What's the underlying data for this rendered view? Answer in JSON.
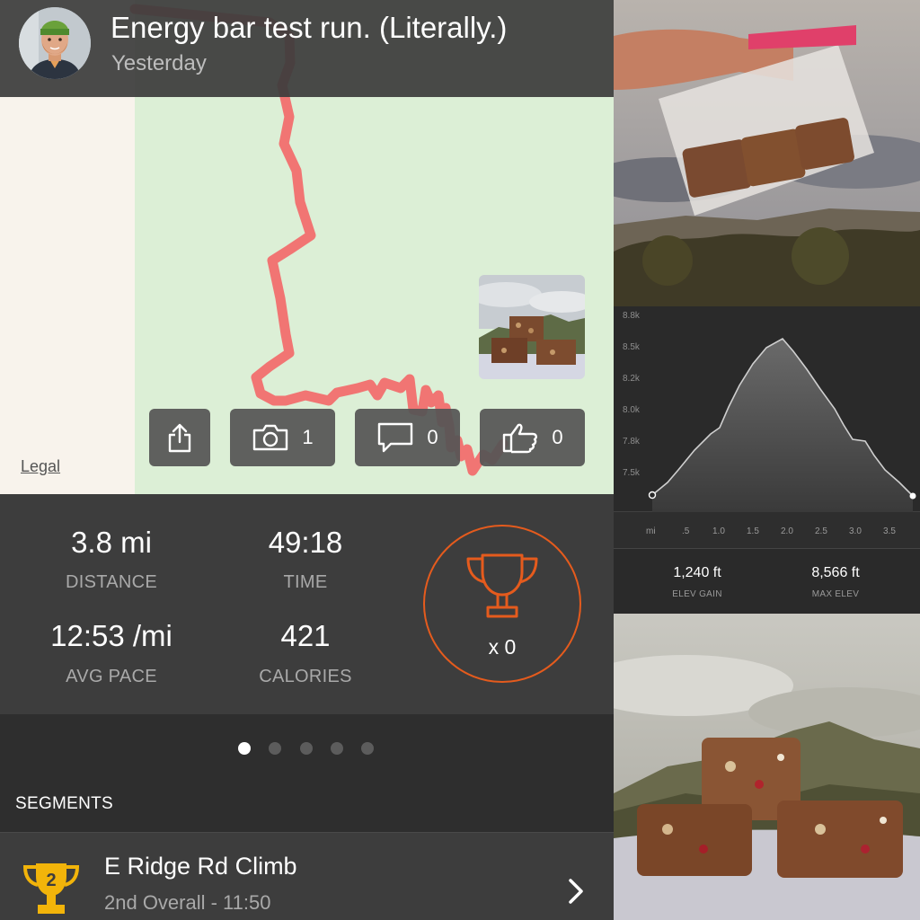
{
  "activity": {
    "title": "Energy bar test run. (Literally.)",
    "date": "Yesterday"
  },
  "map": {
    "legal_label": "Legal"
  },
  "actions": {
    "share_icon": "share-icon",
    "photos_count": "1",
    "comments_count": "0",
    "kudos_count": "0"
  },
  "stats": {
    "distance": {
      "value": "3.8 mi",
      "label": "DISTANCE"
    },
    "time": {
      "value": "49:18",
      "label": "TIME"
    },
    "pace": {
      "value": "12:53 /mi",
      "label": "AVG PACE"
    },
    "calories": {
      "value": "421",
      "label": "CALORIES"
    },
    "achievements": "x 0"
  },
  "pager": {
    "pages": 5,
    "active": 0
  },
  "segments": {
    "header": "SEGMENTS",
    "items": [
      {
        "name": "E Ridge Rd Climb",
        "detail": "2nd Overall - 11:50",
        "rank": "2"
      }
    ]
  },
  "elevation": {
    "y_ticks": [
      "8.8k",
      "8.5k",
      "8.2k",
      "8.0k",
      "7.8k",
      "7.5k"
    ],
    "x_ticks": [
      "mi",
      ".5",
      "1.0",
      "1.5",
      "2.0",
      "2.5",
      "3.0",
      "3.5"
    ],
    "gain": {
      "value": "1,240 ft",
      "label": "ELEV GAIN"
    },
    "max": {
      "value": "8,566 ft",
      "label": "MAX ELEV"
    }
  },
  "colors": {
    "accent": "#e55b1d",
    "route": "#f26a6a",
    "map_green": "#dcefd6",
    "trophy_gold": "#f2b40a"
  }
}
